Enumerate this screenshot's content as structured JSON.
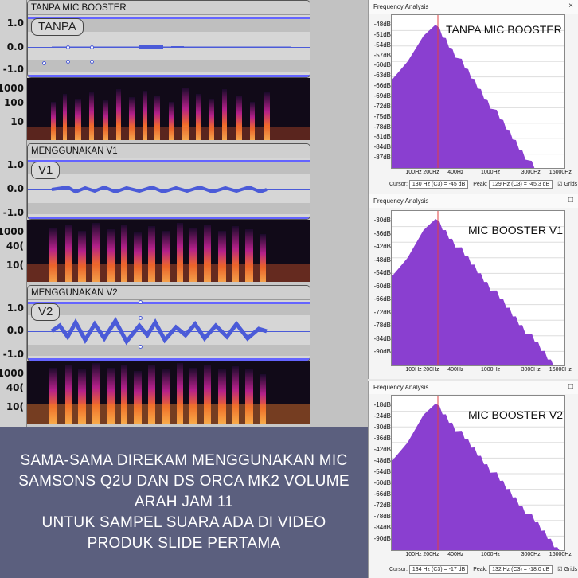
{
  "tracks": [
    {
      "title": "TANPA MIC BOOSTER",
      "label": "TANPA",
      "scale_top": "1.0",
      "scale_mid": "0.0",
      "scale_bot": "-1.0",
      "spec_ticks": [
        "1000",
        "100",
        "10"
      ]
    },
    {
      "title": "MENGGUNAKAN V1",
      "label": "V1",
      "scale_top": "1.0",
      "scale_mid": "0.0",
      "scale_bot": "-1.0",
      "spec_ticks": [
        "1000",
        "40(",
        "10("
      ]
    },
    {
      "title": "MENGGUNAKAN V2",
      "label": "V2",
      "scale_top": "1.0",
      "scale_mid": "0.0",
      "scale_bot": "-1.0",
      "spec_ticks": [
        "1000",
        "40(",
        "10("
      ]
    }
  ],
  "caption": {
    "lines": [
      "SAMA-SAMA DIREKAM MENGGUNAKAN MIC",
      "SAMSONS Q2U DAN DS ORCA MK2 VOLUME",
      "ARAH JAM 11",
      "UNTUK SAMPEL SUARA ADA DI VIDEO",
      "PRODUK SLIDE PERTAMA"
    ]
  },
  "freq_windows": [
    {
      "window_title": "Frequency Analysis",
      "close": "×",
      "plot_label": "TANPA MIC BOOSTER",
      "y_ticks": [
        "-48dB",
        "-51dB",
        "-54dB",
        "-57dB",
        "-60dB",
        "-63dB",
        "-66dB",
        "-69dB",
        "-72dB",
        "-75dB",
        "-78dB",
        "-81dB",
        "-84dB",
        "-87dB"
      ],
      "x_ticks": [
        "100Hz",
        "200Hz",
        "400Hz",
        "1000Hz",
        "3000Hz",
        "16000Hz"
      ],
      "cursor_label": "Cursor:",
      "cursor_value": "130 Hz (C3) = -45 dB",
      "peak_label": "Peak:",
      "peak_value": "129 Hz (C3) = -45.3 dB",
      "grids_label": "Grids"
    },
    {
      "window_title": "Frequency Analysis",
      "close": "□",
      "plot_label": "MIC BOOSTER V1",
      "y_ticks": [
        "-30dB",
        "-36dB",
        "-42dB",
        "-48dB",
        "-54dB",
        "-60dB",
        "-66dB",
        "-72dB",
        "-78dB",
        "-84dB",
        "-90dB"
      ],
      "x_ticks": [
        "100Hz",
        "200Hz",
        "400Hz",
        "1000Hz",
        "3000Hz",
        "16000Hz"
      ],
      "cursor_label": "",
      "cursor_value": "",
      "peak_label": "",
      "peak_value": "",
      "grids_label": ""
    },
    {
      "window_title": "Frequency Analysis",
      "close": "□",
      "plot_label": "MIC BOOSTER V2",
      "y_ticks": [
        "-18dB",
        "-24dB",
        "-30dB",
        "-36dB",
        "-42dB",
        "-48dB",
        "-54dB",
        "-60dB",
        "-66dB",
        "-72dB",
        "-78dB",
        "-84dB",
        "-90dB"
      ],
      "x_ticks": [
        "100Hz",
        "200Hz",
        "400Hz",
        "1000Hz",
        "3000Hz",
        "16000Hz"
      ],
      "cursor_label": "Cursor:",
      "cursor_value": "134 Hz (C3) = -17 dB",
      "peak_label": "Peak:",
      "peak_value": "132 Hz (C3) = -18.0 dB",
      "grids_label": "Grids"
    }
  ]
}
